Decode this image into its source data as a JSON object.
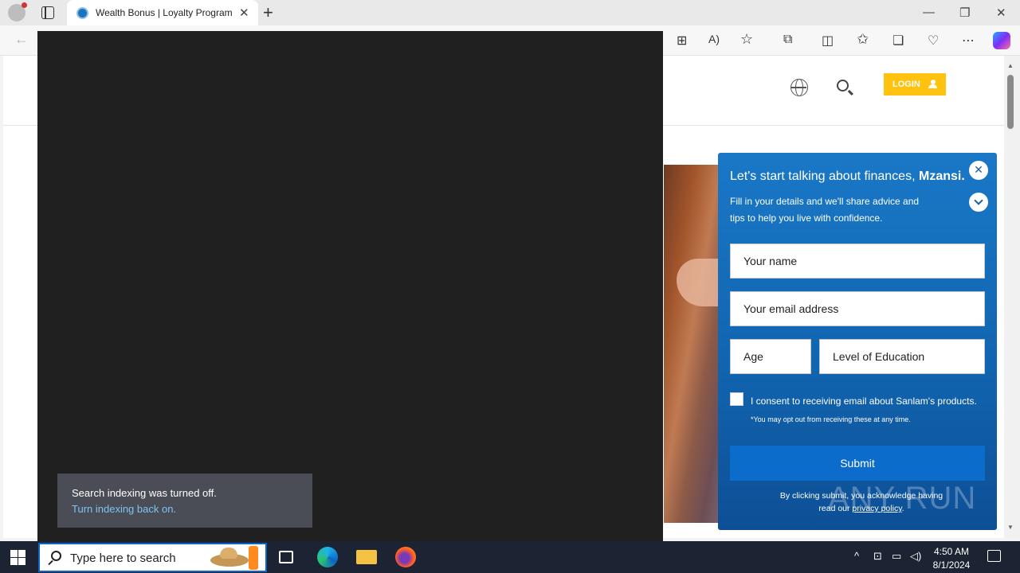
{
  "browser": {
    "tab_title": "Wealth Bonus | Loyalty Programme",
    "tab_close": "✕",
    "new_tab": "+",
    "window_controls": {
      "minimize": "—",
      "restore": "❐",
      "close": "✕"
    },
    "toolbar_icons": [
      "apps-icon",
      "read-aloud-icon",
      "favorite-star-icon",
      "extensions-icon",
      "split-screen-icon",
      "favorites-icon",
      "collections-icon",
      "browser-essentials-icon",
      "more-icon",
      "copilot-icon"
    ],
    "toolbar_glyphs": {
      "back": "←",
      "apps": "⊞",
      "read_aloud": "A)",
      "favorite": "☆",
      "extensions": "⧉",
      "split": "◫",
      "favorites": "✩",
      "collections": "❏",
      "essentials": "♡",
      "more": "⋯"
    }
  },
  "site_header": {
    "login_label": "LOGIN"
  },
  "lead_form": {
    "title_prefix": "Let's start talking about finances,",
    "title_name": "Mzansi.",
    "description": "Fill in your details and we'll share advice and tips to help you live with confidence.",
    "close_glyph": "✕",
    "fields": {
      "name": "Your name",
      "email": "Your email address",
      "age": "Age",
      "education": "Level of Education"
    },
    "consent": "I consent to receiving email about Sanlam's products.",
    "optout": "*You may opt out from receiving these at any time.",
    "submit": "Submit",
    "fine_print_1": "By clicking submit, you acknowledge having",
    "fine_print_2": "read our",
    "privacy_link": "privacy policy",
    "fine_print_end": ".",
    "watermark": "ANY RUN"
  },
  "toast": {
    "message": "Search indexing was turned off.",
    "link": "Turn indexing back on."
  },
  "taskbar": {
    "search_placeholder": "Type here to search",
    "tray_chevron": "^",
    "time": "4:50 AM",
    "date": "8/1/2024"
  },
  "colors": {
    "login_yellow": "#ffc20e",
    "form_blue": "#1a78c7",
    "submit_blue": "#0c6ccb",
    "toast_link": "#7ec3f5",
    "taskbar": "#1c2433"
  }
}
